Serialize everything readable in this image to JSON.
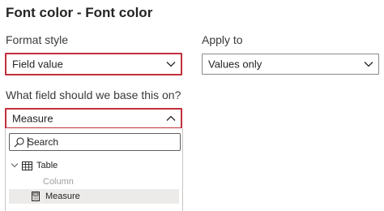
{
  "panel_title": "Font color - Font color",
  "format_style": {
    "label": "Format style",
    "value": "Field value"
  },
  "apply_to": {
    "label": "Apply to",
    "value": "Values only"
  },
  "base_field": {
    "label": "What field should we base this on?",
    "value": "Measure",
    "search_placeholder": "Search",
    "tree": {
      "table_label": "Table",
      "items": [
        {
          "label": "Column",
          "disabled": true
        },
        {
          "label": "Measure",
          "selected": true
        }
      ]
    }
  },
  "colors": {
    "highlight_border": "#c0303a",
    "selected_row_bg": "#edebe9",
    "disabled_text": "#a19f9d"
  }
}
